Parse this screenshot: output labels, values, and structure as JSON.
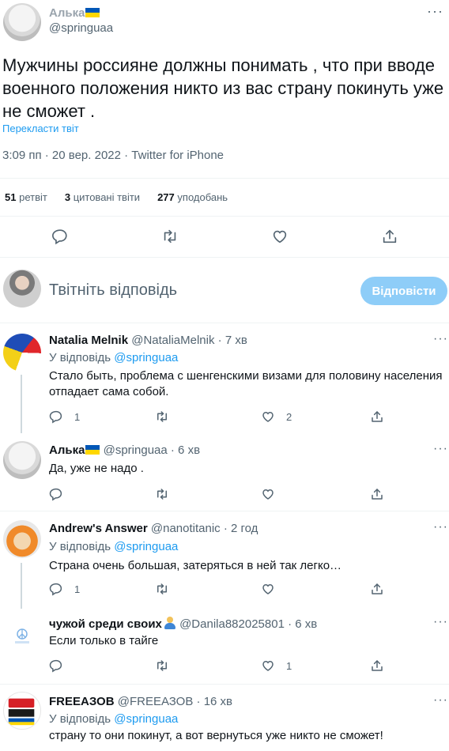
{
  "main_tweet": {
    "author_name": "Алька",
    "author_handle": "@springuaa",
    "text": "Мужчины россияне должны понимать , что при вводе военного положения никто из вас страну покинуть уже не сможет .",
    "translate_label": "Перекласти твіт",
    "timestamp": "3:09 пп · 20 вер. 2022 · Twitter for iPhone",
    "stats": {
      "retweets_count": "51",
      "retweets_label": "ретвіт",
      "quotes_count": "3",
      "quotes_label": "цитовані твіти",
      "likes_count": "277",
      "likes_label": "уподобань"
    }
  },
  "compose": {
    "placeholder": "Твітніть відповідь",
    "button_label": "Відповісти"
  },
  "replies": [
    {
      "name": "Natalia Melnik",
      "handle": "@NataliaMelnik",
      "time": "· 7 хв",
      "reply_to_prefix": "У відповідь",
      "reply_to_handle": "@springuaa",
      "text": "Стало быть, проблема с шенгенскими визами для половину населения отпадает сама собой.",
      "reply_count": "1",
      "retweet_count": "",
      "like_count": "2"
    },
    {
      "name": "Алька",
      "handle": "@springuaa",
      "time": "· 6 хв",
      "text": "Да, уже не надо .",
      "reply_count": "",
      "retweet_count": "",
      "like_count": ""
    },
    {
      "name": "Andrew's Answer",
      "handle": "@nanotitanic",
      "time": "· 2 год",
      "reply_to_prefix": "У відповідь",
      "reply_to_handle": "@springuaa",
      "text": "Страна очень большая, затеряться в ней так легко…",
      "reply_count": "1",
      "retweet_count": "",
      "like_count": ""
    },
    {
      "name": "чужой среди своих",
      "handle": "@Danila882025801",
      "time": "· 6 хв",
      "text": "Если только в тайге",
      "reply_count": "",
      "retweet_count": "",
      "like_count": "1"
    },
    {
      "name": "FREEАЗОВ",
      "handle": "@FREEАЗОВ",
      "time": "· 16 хв",
      "reply_to_prefix": "У відповідь",
      "reply_to_handle": "@springuaa",
      "text": "страну то они покинут, а вот вернуться уже никто не сможет!",
      "reply_count": "",
      "retweet_count": "",
      "like_count": ""
    }
  ],
  "colors": {
    "accent": "#1d9bf0",
    "text": "#0f1419",
    "muted": "#536471",
    "disabled_button": "#8ecdf8",
    "ukraine_blue": "#0057b7",
    "ukraine_yellow": "#ffd700"
  },
  "icons": {
    "reply": "reply-icon",
    "retweet": "retweet-icon",
    "like": "heart-icon",
    "share": "share-icon",
    "more": "more-icon"
  }
}
